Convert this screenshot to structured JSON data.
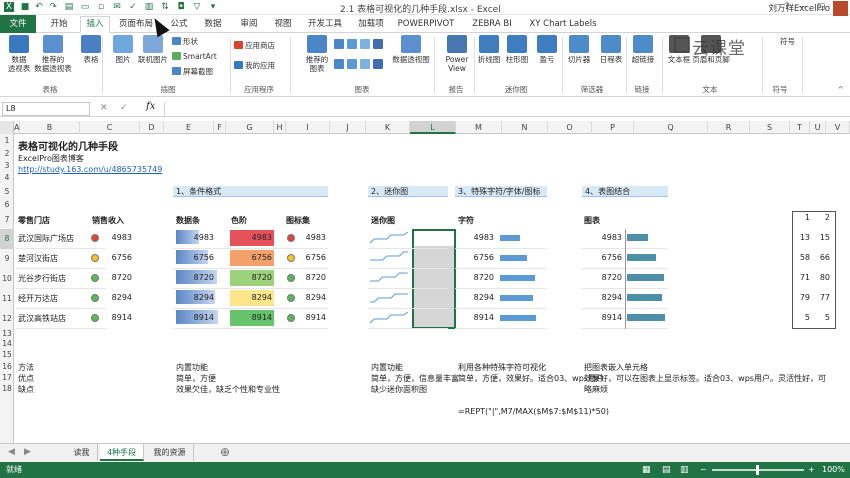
{
  "title_bar": {
    "title": "2.1 表格可视化的几种手段.xlsx - Excel",
    "help": "?",
    "minimize": "—",
    "restore": "▢",
    "close": "✕"
  },
  "tabs": [
    "文件",
    "开始",
    "插入",
    "页面布局",
    "公式",
    "数据",
    "审阅",
    "视图",
    "开发工具",
    "加载项",
    "POWERPIVOT",
    "ZEBRA BI",
    "XY Chart Labels"
  ],
  "active_tab": "插入",
  "user_name": "刘万祥ExcelPro",
  "ribbon": {
    "buttons": [
      {
        "label": "数据\n透视表",
        "icon": "pivot-table-icon",
        "color": "#3c78c0"
      },
      {
        "label": "推荐的\n数据透视表",
        "icon": "recommended-pivot-icon",
        "color": "#5a8fd0"
      },
      {
        "label": "表格",
        "icon": "table-icon",
        "color": "#4a7fc4"
      },
      {
        "label": "图片",
        "icon": "picture-icon",
        "color": "#6fa6dd"
      },
      {
        "label": "联机图片",
        "icon": "online-picture-icon",
        "color": "#7da8d8"
      },
      {
        "label": "推荐的\n图表",
        "icon": "recommended-chart-icon",
        "color": "#4a86c8"
      },
      {
        "label": "数据透视图",
        "icon": "pivot-chart-icon",
        "color": "#5b8fcf"
      },
      {
        "label": "Power\nView",
        "icon": "power-view-icon",
        "color": "#4677b3"
      },
      {
        "label": "折线图",
        "icon": "sparkline-line-icon",
        "color": "#3f7dc0"
      },
      {
        "label": "柱形图",
        "icon": "sparkline-column-icon",
        "color": "#3f7dc0"
      },
      {
        "label": "盈亏",
        "icon": "sparkline-winloss-icon",
        "color": "#3f7dc0"
      },
      {
        "label": "切片器",
        "icon": "slicer-icon",
        "color": "#4f8bc9"
      },
      {
        "label": "日程表",
        "icon": "timeline-icon",
        "color": "#4f8bc9"
      },
      {
        "label": "超链接",
        "icon": "hyperlink-icon",
        "color": "#4f8bc9"
      },
      {
        "label": "文本框",
        "icon": "textbox-icon",
        "color": "#555"
      },
      {
        "label": "页眉和页脚",
        "icon": "header-footer-icon",
        "color": "#555"
      }
    ],
    "small": [
      "形状",
      "SmartArt",
      "屏幕截图",
      "应用商店",
      "我的应用"
    ],
    "groups": [
      "表格",
      "插图",
      "应用程序",
      "图表",
      "报告",
      "迷你图",
      "筛选器",
      "链接",
      "文本",
      "符号"
    ],
    "symbols": "符号"
  },
  "watermark": "云课堂",
  "name_box": "L8",
  "fx_label": "fx",
  "columns": [
    "A",
    "B",
    "C",
    "D",
    "E",
    "F",
    "G",
    "H",
    "I",
    "J",
    "K",
    "L",
    "M",
    "N",
    "O",
    "P",
    "Q",
    "R",
    "S",
    "T",
    "U",
    "V"
  ],
  "rows": [
    "1",
    "2",
    "3",
    "4",
    "5",
    "6",
    "7",
    "8",
    "9",
    "10",
    "11",
    "12",
    "13",
    "14",
    "15",
    "16",
    "17",
    "18"
  ],
  "sheet": {
    "title": "表格可视化的几种手段",
    "subtitle": "ExcelPro图表博客",
    "link": "http://study.163.com/u/4865735749",
    "section1": "1、条件格式",
    "section2": "2、迷你图",
    "section3": "3、特殊字符/字体/图标",
    "section4": "4、表图结合",
    "headers": {
      "store": "零售门店",
      "sales": "销售收入",
      "databar": "数据条",
      "colorscale": "色阶",
      "iconset": "图标集",
      "sparkline": "迷你图",
      "char": "字符",
      "chart": "图表"
    },
    "stores": [
      "武汉国际广场店",
      "楚河汉街店",
      "光谷步行街店",
      "经开万达店",
      "武汉高铁站店"
    ],
    "values": [
      4983,
      6756,
      8720,
      8294,
      8914
    ],
    "value_labels": [
      "4983",
      "6756",
      "8720",
      "8294",
      "8914"
    ],
    "icon_colors": [
      "#e0453b",
      "#f3c22b",
      "#5cb85c",
      "#5cb85c",
      "#5cb85c"
    ],
    "heat_colors": [
      "#e5525a",
      "#f4a06b",
      "#9bd27b",
      "#fde68a",
      "#66c26b"
    ],
    "right_table": [
      [
        "1",
        "2"
      ],
      [
        "13",
        "15"
      ],
      [
        "58",
        "66"
      ],
      [
        "71",
        "80"
      ],
      [
        "79",
        "77"
      ],
      [
        "5",
        "5"
      ]
    ],
    "notes": {
      "methods_label": "方法",
      "pros_label": "优点",
      "cons_label": "缺点",
      "cf_method": "内置功能",
      "cf_pros": "简单，方便",
      "cf_cons": "效果欠佳，缺乏个性和专业性",
      "sp_method": "内置功能",
      "sp_pros": "简单，方便，信息量丰富",
      "sp_cons": "缺少迷你面积图",
      "ch_method": "利用各种特殊字符可视化",
      "ch_pros": "简单，方便，效果好。适合03、wps用户",
      "tb_method": "把图表嵌入单元格",
      "tb_pros": "效果好，可以在图表上显示标签。适合03、wps用户。灵活性好，可",
      "tb_cons": "略麻烦",
      "formula": "=REPT(\"|\",M7/MAX($M$7:$M$11)*50)"
    }
  },
  "sheet_tabs": [
    "读我",
    "4种手段",
    "我的资源"
  ],
  "active_sheet": "4种手段",
  "status": {
    "ready": "就绪",
    "zoom": "100%"
  }
}
